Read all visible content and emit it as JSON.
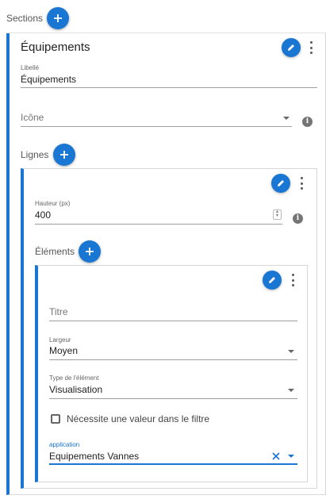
{
  "sections_label": "Sections",
  "section": {
    "title": "Équipements",
    "libelle": {
      "label": "Libellé",
      "value": "Équipements"
    },
    "icone": {
      "placeholder": "Icône"
    },
    "lignes_label": "Lignes",
    "ligne": {
      "hauteur": {
        "label": "Hauteur (px)",
        "value": "400"
      },
      "elements_label": "Éléments",
      "element": {
        "titre": {
          "placeholder": "Titre"
        },
        "largeur": {
          "label": "Largeur",
          "value": "Moyen"
        },
        "type": {
          "label": "Type de l'élément",
          "value": "Visualisation"
        },
        "checkbox_label": "Nécessite une valeur dans le filtre",
        "application": {
          "label": "application",
          "value": "Equipements Vannes"
        }
      }
    }
  },
  "icons": {
    "add": "plus-icon",
    "edit": "pencil-icon",
    "more": "more-vert-icon",
    "info": "info-icon",
    "dropdown": "arrow-drop-down-icon",
    "clear": "close-icon"
  },
  "colors": {
    "accent": "#1976d2"
  }
}
